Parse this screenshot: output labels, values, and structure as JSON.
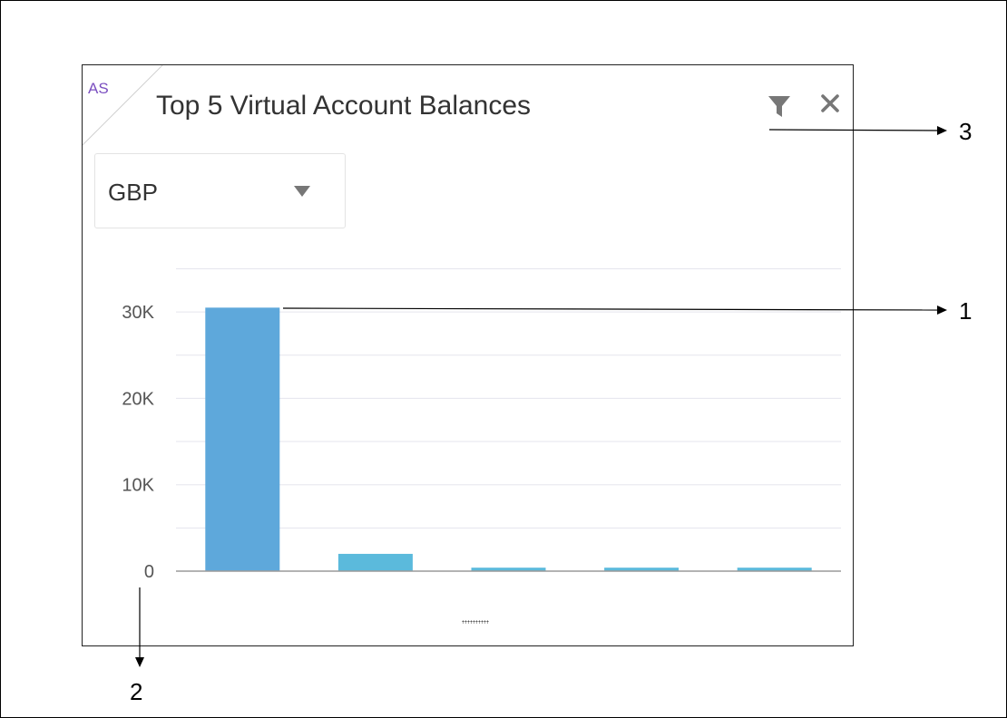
{
  "widget": {
    "badge": "AS",
    "title": "Top 5 Virtual Account Balances",
    "currency": {
      "selected": "GBP"
    },
    "icons": {
      "filter": "filter-icon",
      "close": "close-icon"
    }
  },
  "chart_data": {
    "type": "bar",
    "categories": [
      "",
      "",
      "",
      "",
      ""
    ],
    "values": [
      30500,
      2000,
      400,
      400,
      400
    ],
    "ylim": [
      0,
      35000
    ],
    "yticks": [
      0,
      10000,
      20000,
      30000
    ],
    "ytick_labels": [
      "0",
      "10K",
      "20K",
      "30K"
    ],
    "grid": true,
    "colors": {
      "bars": "#5ea8db",
      "bars_small": "#5bbadc",
      "grid": "#e5e5ee",
      "axis": "#9a9a9a"
    }
  },
  "callouts": [
    "1",
    "2",
    "3"
  ]
}
